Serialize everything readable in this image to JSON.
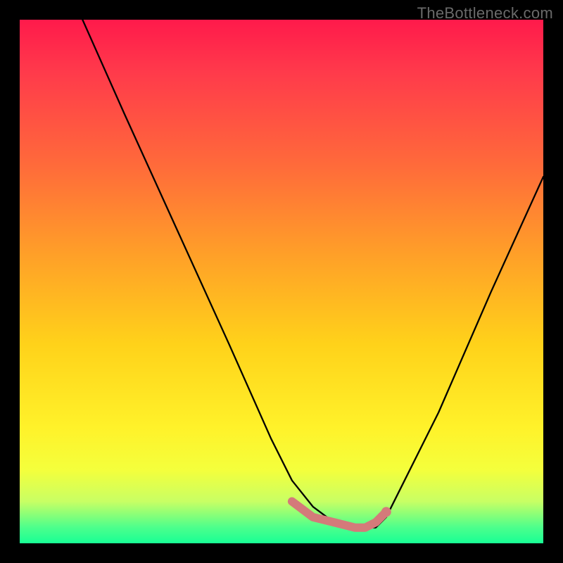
{
  "watermark": "TheBottleneck.com",
  "chart_data": {
    "type": "line",
    "title": "",
    "xlabel": "",
    "ylabel": "",
    "xlim": [
      0,
      100
    ],
    "ylim": [
      0,
      100
    ],
    "grid": false,
    "legend": false,
    "series": [
      {
        "name": "black-curve",
        "color": "#000000",
        "x": [
          12,
          20,
          30,
          40,
          48,
          52,
          56,
          60,
          64,
          66,
          68,
          70,
          80,
          90,
          100
        ],
        "values": [
          100,
          82,
          60,
          38,
          20,
          12,
          7,
          4,
          3,
          3,
          3,
          5,
          25,
          48,
          70
        ]
      },
      {
        "name": "pink-bottom-segment",
        "color": "#d47a7a",
        "x": [
          52,
          56,
          60,
          64,
          66,
          68,
          70
        ],
        "values": [
          8,
          5,
          4,
          3,
          3,
          4,
          6
        ]
      }
    ],
    "background_gradient": {
      "direction": "vertical",
      "stops": [
        {
          "pos": 0,
          "color": "#ff1a4b"
        },
        {
          "pos": 28,
          "color": "#ff6b3a"
        },
        {
          "pos": 62,
          "color": "#ffd21a"
        },
        {
          "pos": 92,
          "color": "#c8ff64"
        },
        {
          "pos": 100,
          "color": "#18ff95"
        }
      ]
    }
  }
}
